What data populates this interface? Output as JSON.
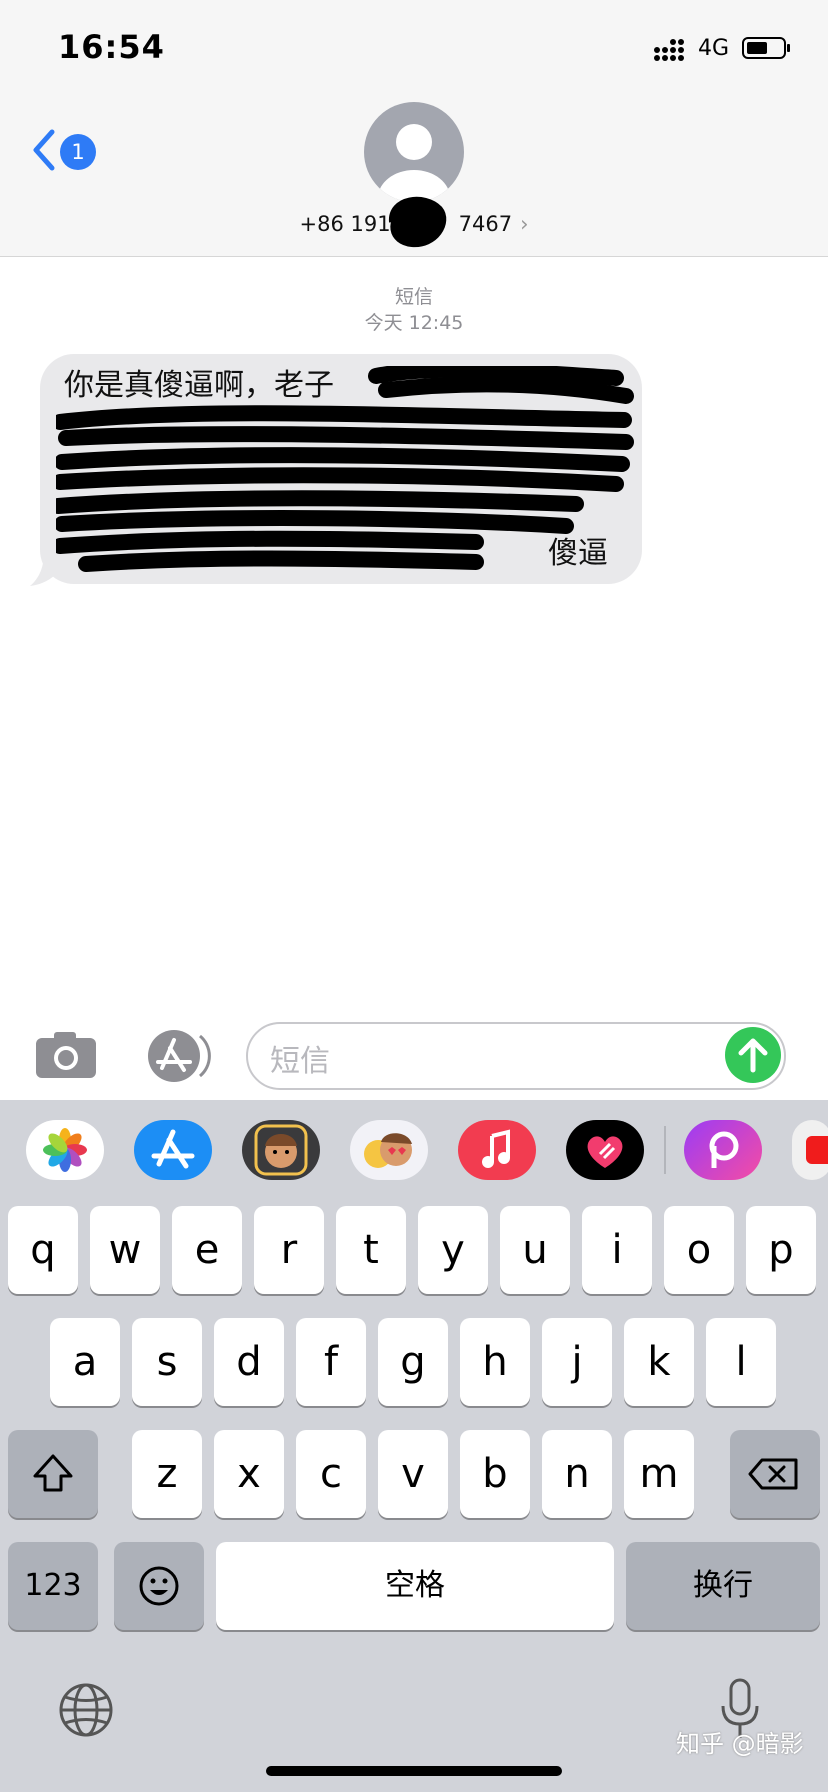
{
  "status_bar": {
    "time": "16:54",
    "network": "4G"
  },
  "header": {
    "back_badge": "1",
    "contact_number_prefix": "+86 191",
    "contact_number_suffix": "7467",
    "chevron": "›"
  },
  "thread": {
    "service_label": "短信",
    "timestamp": "今天 12:45",
    "message_start": "你是真傻逼啊，老子",
    "message_end": "傻逼"
  },
  "input": {
    "placeholder": "短信"
  },
  "apps": [
    "photos-icon",
    "appstore-icon",
    "memoji-icon",
    "animoji-icon",
    "music-icon",
    "heart-app-icon",
    "picsart-icon",
    "youtube-icon"
  ],
  "keyboard": {
    "row1": [
      "q",
      "w",
      "e",
      "r",
      "t",
      "y",
      "u",
      "i",
      "o",
      "p"
    ],
    "row2": [
      "a",
      "s",
      "d",
      "f",
      "g",
      "h",
      "j",
      "k",
      "l"
    ],
    "row3": [
      "z",
      "x",
      "c",
      "v",
      "b",
      "n",
      "m"
    ],
    "numbers_label": "123",
    "space_label": "空格",
    "return_label": "换行"
  },
  "watermark": "知乎 @暗影",
  "colors": {
    "accent": "#2e7bf6",
    "send": "#34c759",
    "keyboard_bg": "#d1d3d9",
    "bubble": "#e9e9eb"
  }
}
